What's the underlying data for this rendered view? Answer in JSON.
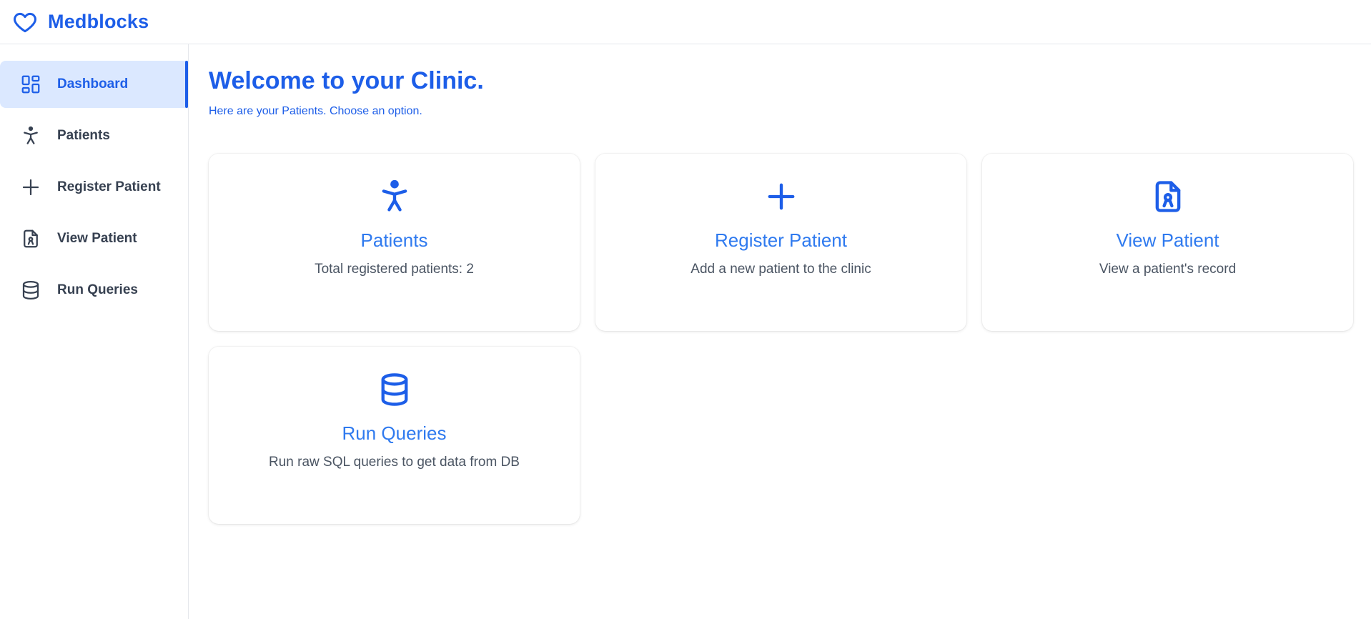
{
  "brand": {
    "name": "Medblocks",
    "icon": "heart-icon"
  },
  "sidebar": {
    "items": [
      {
        "label": "Dashboard",
        "icon": "dashboard-icon",
        "active": true
      },
      {
        "label": "Patients",
        "icon": "person-icon",
        "active": false
      },
      {
        "label": "Register Patient",
        "icon": "plus-icon",
        "active": false
      },
      {
        "label": "View Patient",
        "icon": "patient-file-icon",
        "active": false
      },
      {
        "label": "Run Queries",
        "icon": "database-icon",
        "active": false
      }
    ]
  },
  "main": {
    "title": "Welcome to your Clinic.",
    "subtitle": "Here are your Patients. Choose an option.",
    "cards": [
      {
        "title": "Patients",
        "description": "Total registered patients: 2",
        "icon": "person-icon"
      },
      {
        "title": "Register Patient",
        "description": "Add a new patient to the clinic",
        "icon": "plus-icon"
      },
      {
        "title": "View Patient",
        "description": "View a patient's record",
        "icon": "patient-file-icon"
      },
      {
        "title": "Run Queries",
        "description": "Run raw SQL queries to get data from DB",
        "icon": "database-icon"
      }
    ]
  },
  "colors": {
    "accent": "#1d5ee8",
    "card_title": "#2f7aef",
    "active_bg": "#dbe8ff",
    "text": "#374151"
  }
}
